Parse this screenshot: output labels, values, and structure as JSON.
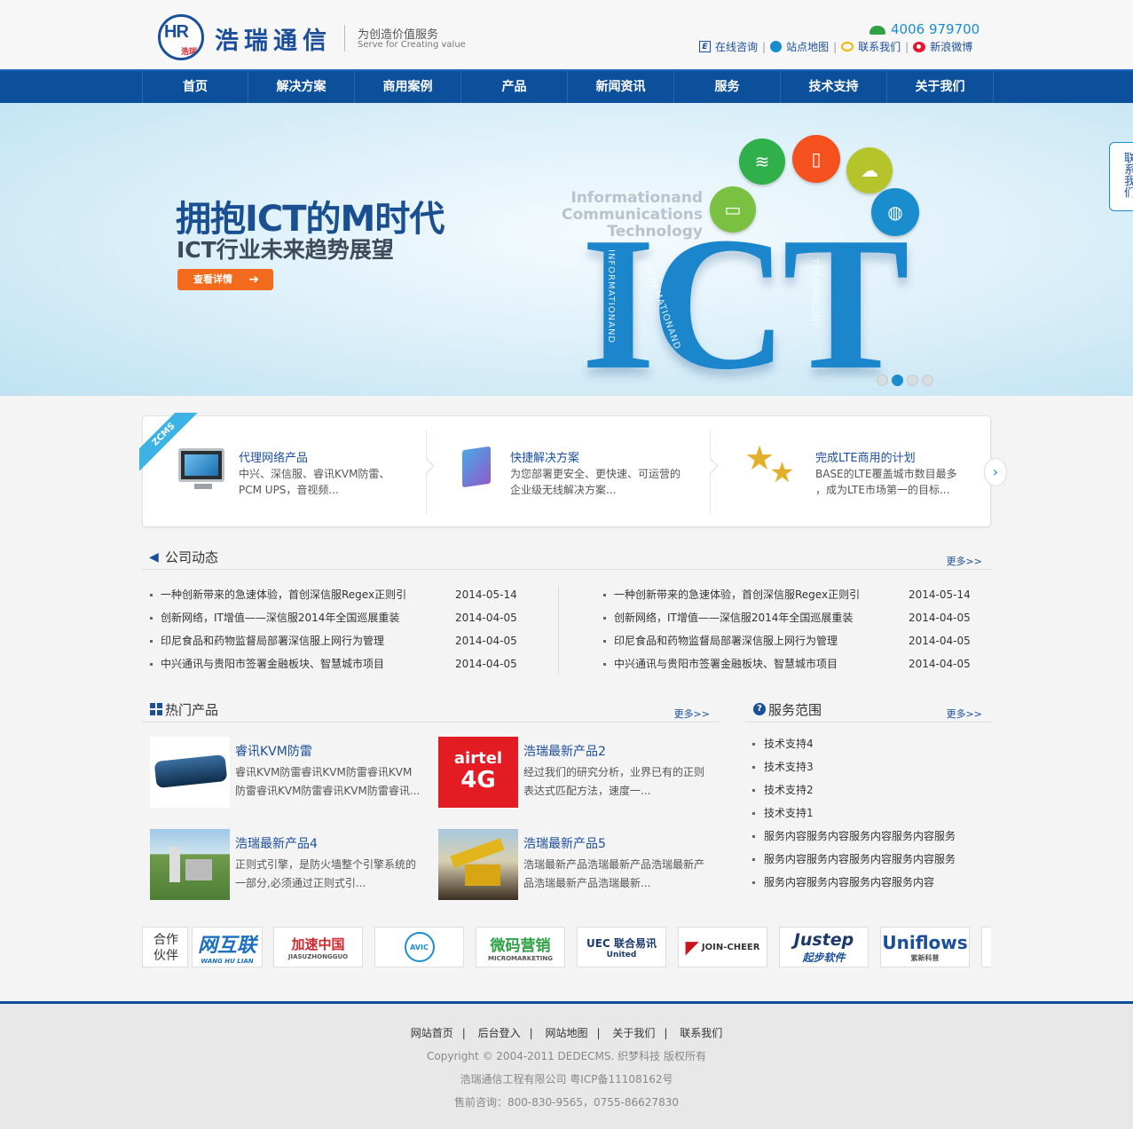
{
  "header": {
    "logo_letters": "HR",
    "logo_sub": "浩瑞",
    "brand": "浩瑞通信",
    "slogan_cn": "为创造价值服务",
    "slogan_en": "Serve for Creating value",
    "phone": "4006 979700",
    "links": [
      {
        "label": "在线咨询",
        "icon": "e-icon"
      },
      {
        "label": "站点地图",
        "icon": "globe-icon"
      },
      {
        "label": "联系我们",
        "icon": "chat-bubble-icon"
      },
      {
        "label": "新浪微博",
        "icon": "weibo-icon"
      }
    ]
  },
  "nav": [
    "首页",
    "解决方案",
    "商用案例",
    "产品",
    "新闻资讯",
    "服务",
    "技术支持",
    "关于我们"
  ],
  "banner": {
    "title": "拥抱ICT的M时代",
    "subtitle": "ICT行业未来趋势展望",
    "button": "查看详情",
    "ict_caption": "Informationand Communications Technology",
    "ict_big": "ICT",
    "side_words": [
      "INFORMATIONAND",
      "INFORMATIONAND",
      "TECHNOLOGY"
    ],
    "slides": 4,
    "active_slide": 2
  },
  "side_tab": "联系我们",
  "features": {
    "ribbon": "ZCMS",
    "items": [
      {
        "title": "代理网络产品",
        "desc1": "中兴、深信服、睿讯KVM防雷、",
        "desc2": "PCM UPS，音视频...",
        "icon": "monitor-icon"
      },
      {
        "title": "快捷解决方案",
        "desc1": "为您部署更安全、更快速、可运营的",
        "desc2": "企业级无线解决方案...",
        "icon": "puzzle-icon"
      },
      {
        "title": "完成LTE商用的计划",
        "desc1": "BASE的LTE覆盖城市数目最多",
        "desc2": "，成为LTE市场第一的目标...",
        "icon": "stars-icon"
      }
    ]
  },
  "company_news": {
    "title": "公司动态",
    "more": "更多>>",
    "left": [
      {
        "title": "一种创新带来的急速体验，首创深信服Regex正则引",
        "date": "2014-05-14"
      },
      {
        "title": "创新网络，IT增值——深信服2014年全国巡展重装",
        "date": "2014-04-05"
      },
      {
        "title": "印尼食品和药物监督局部署深信服上网行为管理",
        "date": "2014-04-05"
      },
      {
        "title": "中兴通讯与贵阳市签署金融板块、智慧城市项目",
        "date": "2014-04-05"
      }
    ],
    "right": [
      {
        "title": "一种创新带来的急速体验，首创深信服Regex正则引",
        "date": "2014-05-14"
      },
      {
        "title": "创新网络，IT增值——深信服2014年全国巡展重装",
        "date": "2014-04-05"
      },
      {
        "title": "印尼食品和药物监督局部署深信服上网行为管理",
        "date": "2014-04-05"
      },
      {
        "title": "中兴通讯与贵阳市签署金融板块、智慧城市项目",
        "date": "2014-04-05"
      }
    ]
  },
  "hot_products": {
    "title": "热门产品",
    "more": "更多>>",
    "items": [
      {
        "name": "睿讯KVM防雷",
        "d1": "睿讯KVM防雷睿讯KVM防雷睿讯KVM",
        "d2": "防雷睿讯KVM防雷睿讯KVM防雷睿讯..."
      },
      {
        "name": "浩瑞最新产品2",
        "d1": "经过我们的研究分析，业界已有的正则",
        "d2": "表达式匹配方法，速度一...",
        "img_text1": "airtel",
        "img_text2": "4G"
      },
      {
        "name": "浩瑞最新产品4",
        "d1": "正则式引擎，是防火墙整个引擎系统的",
        "d2": "一部分,必须通过正则式引..."
      },
      {
        "name": "浩瑞最新产品5",
        "d1": "浩瑞最新产品浩瑞最新产品浩瑞最新产",
        "d2": "品浩瑞最新产品浩瑞最新..."
      }
    ]
  },
  "services": {
    "title": "服务范围",
    "more": "更多>>",
    "items": [
      "技术支持4",
      "技术支持3",
      "技术支持2",
      "技术支持1",
      "服务内容服务内容服务内容服务内容服务",
      "服务内容服务内容服务内容服务内容服务",
      "服务内容服务内容服务内容服务内容"
    ]
  },
  "partners": {
    "label1": "合作",
    "label2": "伙伴",
    "logos": [
      {
        "text": "网互联",
        "sub": "WANG HU LIAN",
        "color": "#1b6fc0"
      },
      {
        "text": "加速中国",
        "sub": "JIASUZHONGGUO",
        "color": "#d2262c"
      },
      {
        "text": "AVIC",
        "sub": "",
        "color": "#1a8dcf"
      },
      {
        "text": "微码营销",
        "sub": "MICROMARKETING",
        "color": "#2fa245"
      },
      {
        "text": "UEC 联合易讯",
        "sub": "United",
        "color": "#1b3a6b"
      },
      {
        "text": "JOIN-CHEER",
        "sub": "",
        "color": "#c8161d"
      },
      {
        "text": "Justep",
        "sub": "起步软件",
        "color": "#1b3a6b"
      },
      {
        "text": "Uniflows",
        "sub": "紫新科普",
        "color": "#1b4f9c"
      }
    ]
  },
  "footer": {
    "links": [
      "网站首页",
      "后台登入",
      "网站地图",
      "关于我们",
      "联系我们"
    ],
    "copyright": "Copyright © 2004-2011 DEDECMS. 织梦科技 版权所有",
    "company": "浩瑞通信工程有限公司 粤ICP备11108162号",
    "hotline": "售前咨询：800-830-9565，0755-86627830"
  }
}
